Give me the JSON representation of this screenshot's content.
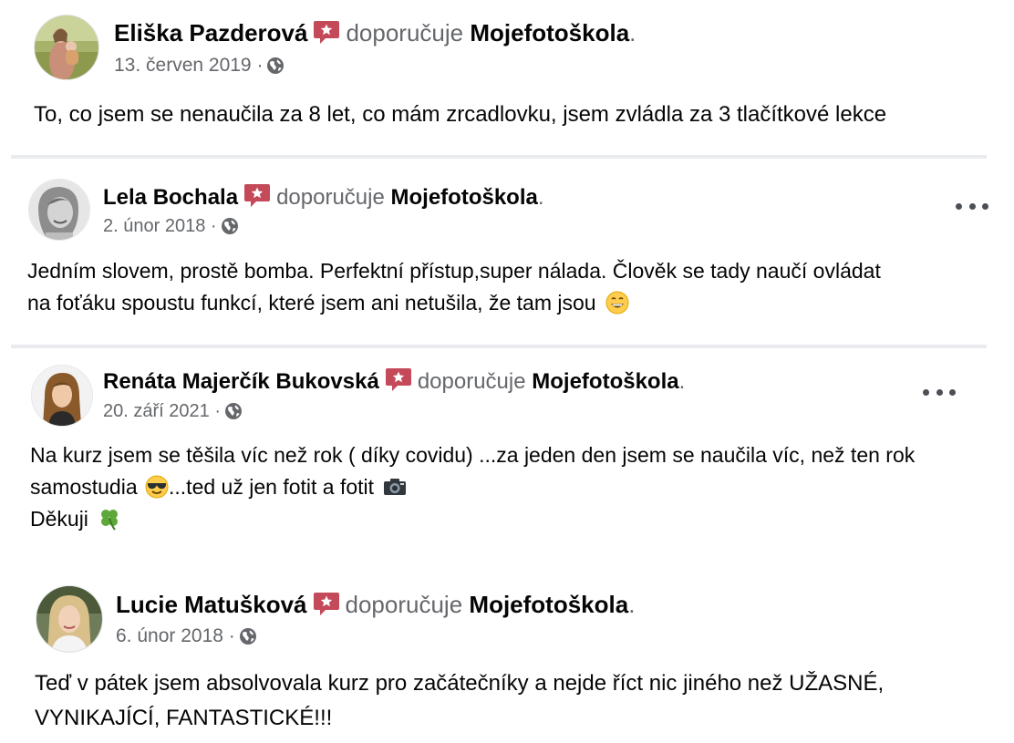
{
  "reviews": [
    {
      "name": "Eliška Pazderová",
      "verb": "doporučuje",
      "page": "Mojefotoškola",
      "date": "13. červen 2019",
      "separator": "·",
      "lines": [
        "To, co jsem se nenaučila za 8 let, co mám zrcadlovku, jsem zvládla za 3 tlačítkové lekce"
      ]
    },
    {
      "name": "Lela Bochala",
      "verb": "doporučuje",
      "page": "Mojefotoškola",
      "date": "2. únor 2018",
      "separator": "·",
      "lines": [
        "Jedním slovem, prostě bomba. Perfektní přístup,super nálada. Člověk se tady naučí ovládat",
        "na foťáku spoustu funkcí, které jsem ani netušila, že tam jsou"
      ]
    },
    {
      "name": "Renáta Majerčík Bukovská",
      "verb": "doporučuje",
      "page": "Mojefotoškola",
      "date": "20. září 2021",
      "separator": "·",
      "lines": [
        "Na kurz jsem se těšila víc než rok ( díky covidu) ...za jeden den jsem se naučila víc, než ten rok",
        "samostudia",
        "...ted už jen fotit a fotit",
        "Děkuji"
      ]
    },
    {
      "name": "Lucie Matušková",
      "verb": "doporučuje",
      "page": "Mojefotoškola",
      "date": "6. únor 2018",
      "separator": "·",
      "lines": [
        "Teď v pátek jsem absolvovala kurz pro začátečníky a nejde říct nic jiného než UŽASNÉ,",
        "VYNIKAJÍCÍ, FANTASTICKÉ!!!"
      ]
    }
  ],
  "period": ".",
  "icons": {
    "recommend": "recommend-badge-icon",
    "privacy": "globe-icon",
    "more": "more-options-icon",
    "emoji_grin": "grinning-face-icon",
    "emoji_sunglasses": "sunglasses-face-icon",
    "emoji_camera": "camera-icon",
    "emoji_clover": "four-leaf-clover-icon"
  },
  "colors": {
    "badge": "#c44a5a",
    "secondary_text": "#65676b",
    "primary_text": "#050505",
    "divider": "#e9ebee"
  }
}
